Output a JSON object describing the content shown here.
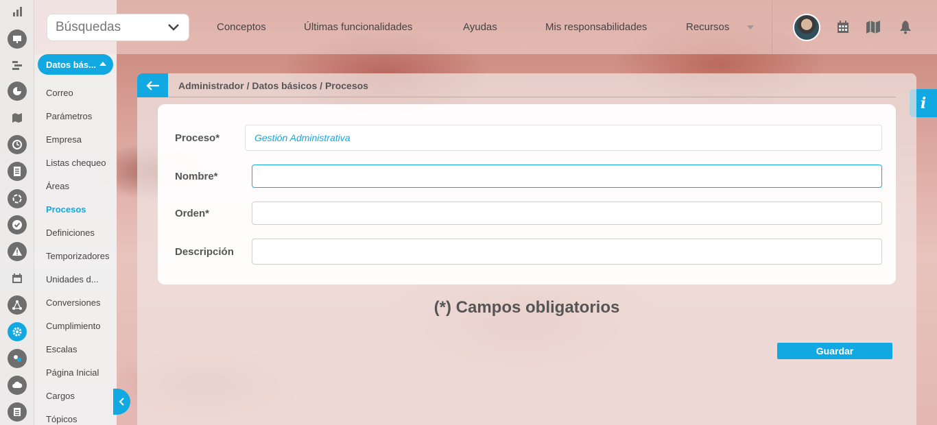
{
  "search": {
    "label": "Búsquedas"
  },
  "nav": {
    "links": [
      "Conceptos",
      "Últimas funcionalidades",
      "Ayudas",
      "Mis responsabilidades",
      "Recursos"
    ]
  },
  "rail": {
    "icons": [
      "bar-chart-icon",
      "presentation-icon",
      "gantt-icon",
      "pie-chart-icon",
      "map-icon",
      "clock-icon",
      "document-icon",
      "cycle-icon",
      "check-icon",
      "warning-icon",
      "calendar-icon",
      "network-icon",
      "gear-icon",
      "users-icon",
      "cloud-icon",
      "list-icon"
    ],
    "active": "gear-icon"
  },
  "sidemenu": {
    "section_label": "Datos bás...",
    "items": [
      "Correo",
      "Parámetros",
      "Empresa",
      "Listas chequeo",
      "Áreas",
      "Procesos",
      "Definiciones",
      "Temporizadores",
      "Unidades d...",
      "Conversiones",
      "Cumplimiento",
      "Escalas",
      "Página Inicial",
      "Cargos",
      "Tópicos"
    ],
    "active_item": "Procesos"
  },
  "breadcrumb": "Administrador / Datos básicos / Procesos",
  "form": {
    "proceso_label": "Proceso*",
    "proceso_value": "Gestión Administrativa",
    "nombre_label": "Nombre*",
    "nombre_value": "",
    "orden_label": "Orden*",
    "orden_value": "",
    "descripcion_label": "Descripción",
    "descripcion_value": ""
  },
  "required_note": "(*) Campos obligatorios",
  "save_label": "Guardar",
  "info_label": "i",
  "colors": {
    "accent": "#12a9e2",
    "text": "#555555"
  }
}
